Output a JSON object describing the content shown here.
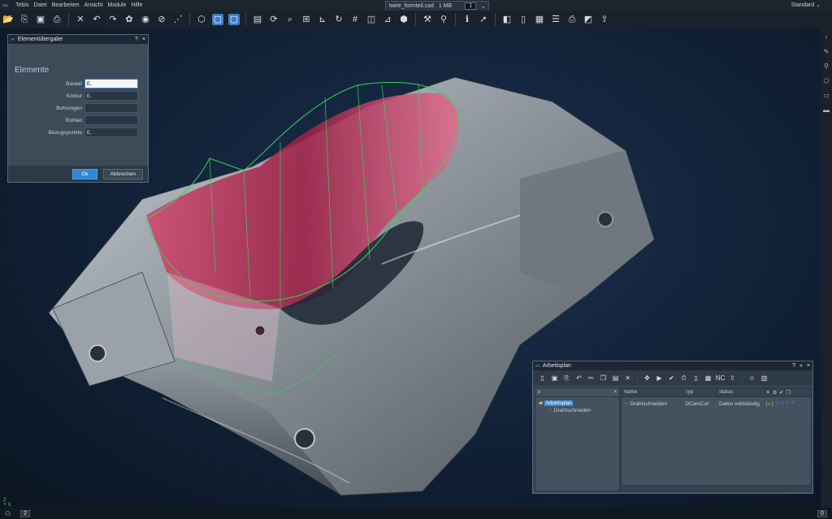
{
  "menubar": {
    "items": [
      "Tebis",
      "Datei",
      "Bearbeiten",
      "Ansicht",
      "Module",
      "Hilfe"
    ],
    "document_tab": {
      "name": "twire_formteil.cad",
      "size": "1 MB",
      "page": "1"
    },
    "profile": "Standard"
  },
  "toolbar": {
    "icons": [
      "open-icon",
      "save-as-icon",
      "save-icon",
      "print-icon",
      "delete-icon",
      "undo-icon",
      "redo-icon",
      "group-icon",
      "visibility-icon",
      "hide-icon",
      "select-icon",
      "view-iso-icon",
      "view-top-icon",
      "view-front-icon",
      "shade-icon",
      "refresh-icon",
      "zoom-icon",
      "fit-icon",
      "axis-icon",
      "rotate-icon",
      "grid-icon",
      "frame-icon",
      "section-icon",
      "model-icon",
      "measure-icon",
      "analyze-icon",
      "info-icon",
      "pointer-icon",
      "layer-icon",
      "doc-icon",
      "page-icon",
      "list-icon",
      "print-view-icon",
      "render-icon",
      "export-icon"
    ]
  },
  "element_dialog": {
    "title": "Elementübergabe",
    "help": "?",
    "close": "×",
    "heading": "Elemente",
    "fields": [
      {
        "label": "Bauteil",
        "value": "E,"
      },
      {
        "label": "Kontur",
        "value": "E,"
      },
      {
        "label": "Bohrungen",
        "value": ""
      },
      {
        "label": "Rohteil",
        "value": ""
      },
      {
        "label": "Bezugspunkte",
        "value": "E,"
      }
    ],
    "ok_label": "Ok",
    "cancel_label": "Abbrechen"
  },
  "arbeitsplan": {
    "title": "Arbeitsplan",
    "help": "?",
    "collapse": "«",
    "close": "×",
    "search_clear": "×",
    "tree": [
      {
        "label": "Arbeitsplan",
        "selected": true
      },
      {
        "label": "Drahtschneiden",
        "selected": false
      }
    ],
    "columns": {
      "name": "Name",
      "typ": "Typ",
      "status": "Status"
    },
    "rows": [
      {
        "name": "Drahtschneiden",
        "typ": "DCamCut",
        "status": "Daten vollständig",
        "flag": "(✓)",
        "q1": "?",
        "q2": "?",
        "q3": "?",
        "q4": "?"
      }
    ]
  },
  "statusbar": {
    "left_count": "2",
    "right_count": "0"
  },
  "colors": {
    "accent": "#3b86d6",
    "pocket": "#b0244f",
    "wire": "#35d05a",
    "background": "#12233a"
  }
}
